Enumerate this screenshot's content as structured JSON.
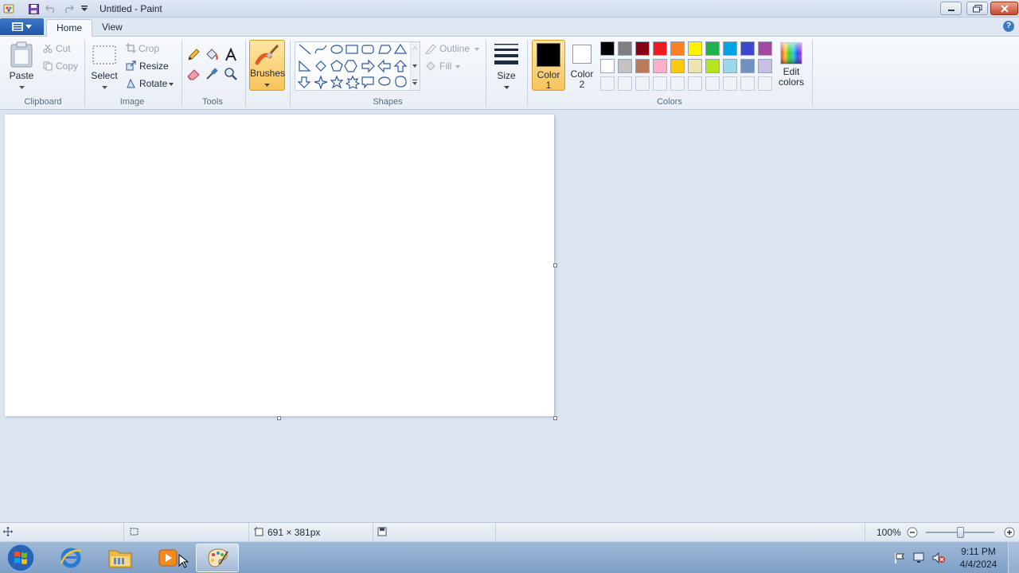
{
  "window": {
    "title": "Untitled - Paint"
  },
  "tabs": [
    {
      "label": "Home"
    },
    {
      "label": "View"
    }
  ],
  "clipboard": {
    "paste_label": "Paste",
    "cut_label": "Cut",
    "copy_label": "Copy",
    "group_label": "Clipboard"
  },
  "image": {
    "select_label": "Select",
    "crop_label": "Crop",
    "resize_label": "Resize",
    "rotate_label": "Rotate",
    "group_label": "Image"
  },
  "tools": {
    "group_label": "Tools"
  },
  "brushes": {
    "label": "Brushes"
  },
  "shapes": {
    "outline_label": "Outline",
    "fill_label": "Fill",
    "group_label": "Shapes"
  },
  "size": {
    "label": "Size"
  },
  "colors": {
    "color1_label_line1": "Color",
    "color1_label_line2": "1",
    "color2_label_line1": "Color",
    "color2_label_line2": "2",
    "edit_label_line1": "Edit",
    "edit_label_line2": "colors",
    "group_label": "Colors",
    "color1": "#000000",
    "color2": "#ffffff",
    "palette_row1": [
      "#000000",
      "#7f7f7f",
      "#880015",
      "#ed1c24",
      "#ff7f27",
      "#fff200",
      "#22b14c",
      "#00a2e8",
      "#3f48cc",
      "#a349a4"
    ],
    "palette_row2": [
      "#ffffff",
      "#c3c3c3",
      "#b97a57",
      "#ffaec9",
      "#ffc90e",
      "#efe4b0",
      "#b5e61d",
      "#99d9ea",
      "#7092be",
      "#c8bfe7"
    ]
  },
  "status": {
    "canvas_size": "691 × 381px",
    "zoom": "100%"
  },
  "taskbar": {
    "time": "9:11 PM",
    "date": "4/4/2024"
  }
}
